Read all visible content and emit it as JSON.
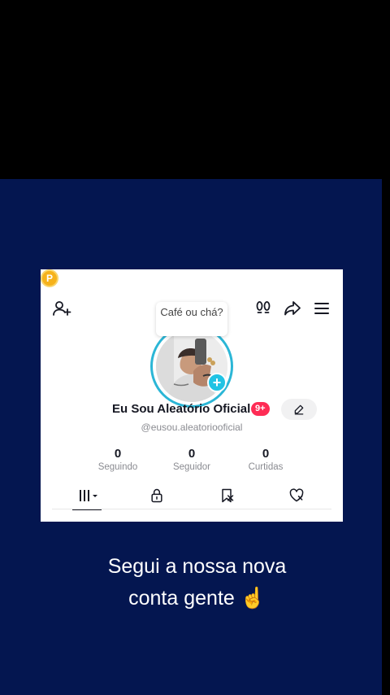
{
  "profile": {
    "tooltip": "Café ou chá?",
    "coin_letter": "P",
    "name": "Eu Sou Aleatório Oficial",
    "badge": "9+",
    "handle": "@eusou.aleatoriooficial",
    "stats": [
      {
        "value": "0",
        "label": "Seguindo"
      },
      {
        "value": "0",
        "label": "Seguidor"
      },
      {
        "value": "0",
        "label": "Curtidas"
      }
    ]
  },
  "icons": {
    "add_user": "add-user-icon",
    "coin": "coin-icon",
    "footprints": "footprints-icon",
    "share": "share-icon",
    "menu": "menu-icon",
    "edit": "pencil-icon",
    "tab_videos": "grid-icon",
    "tab_private": "lock-icon",
    "tab_saved": "bookmark-icon",
    "tab_liked": "heart-icon"
  },
  "caption": {
    "line1": "Segui a nossa nova",
    "line2": "conta gente ☝️"
  },
  "colors": {
    "background_navy": "#041650",
    "accent_ring": "#2bb6d6",
    "badge": "#fe2c55",
    "coin": "#f6b21b"
  }
}
